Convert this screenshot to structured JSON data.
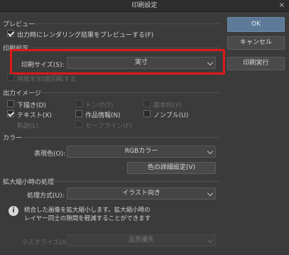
{
  "window": {
    "title": "印刷設定",
    "close": "×"
  },
  "preview": {
    "section": "プレビュー",
    "show_render_result": {
      "label": "出力時にレンダリング結果をプレビューする(F)",
      "checked": true
    }
  },
  "print_settings": {
    "section": "印刷設定",
    "print_size_label": "印刷サイズ(S):",
    "print_size_value": "実寸",
    "rotate_label": "用紙を90度回転する",
    "rotate_checked": false
  },
  "output_image": {
    "section": "出力イメージ",
    "items": [
      {
        "label": "下描き(D)",
        "checked": false,
        "enabled": true
      },
      {
        "label": "トンボ(T)",
        "checked": false,
        "enabled": false
      },
      {
        "label": "基本枠(Y)",
        "checked": false,
        "enabled": false
      },
      {
        "label": "テキスト(X)",
        "checked": true,
        "enabled": true
      },
      {
        "label": "作品情報(N)",
        "checked": false,
        "enabled": true
      },
      {
        "label": "ノンブル(U)",
        "checked": false,
        "enabled": true
      },
      {
        "label": "軌跡(L)",
        "checked": false,
        "enabled": false
      },
      {
        "label": "セーフライン(F)",
        "checked": false,
        "enabled": false
      }
    ]
  },
  "color": {
    "section": "カラー",
    "expression_label": "表現色(O):",
    "expression_value": "RGBカラー",
    "detail_button": "色の詳細設定(V)"
  },
  "scaling": {
    "section": "拡大縮小時の処理",
    "method_label": "処理方式(U):",
    "method_value": "イラスト向き",
    "info_line1": "統合した画像を拡大縮小します。拡大縮小時の",
    "info_line2": "レイヤー同士の隙間を軽減することができます",
    "rasterize_label": "ラスタライズ(A):",
    "rasterize_value": "品質優先"
  },
  "buttons": {
    "ok": "OK",
    "cancel": "キャンセル",
    "print": "印刷実行"
  },
  "colors": {
    "highlight": "#e01818",
    "primary": "#5d7a98"
  }
}
